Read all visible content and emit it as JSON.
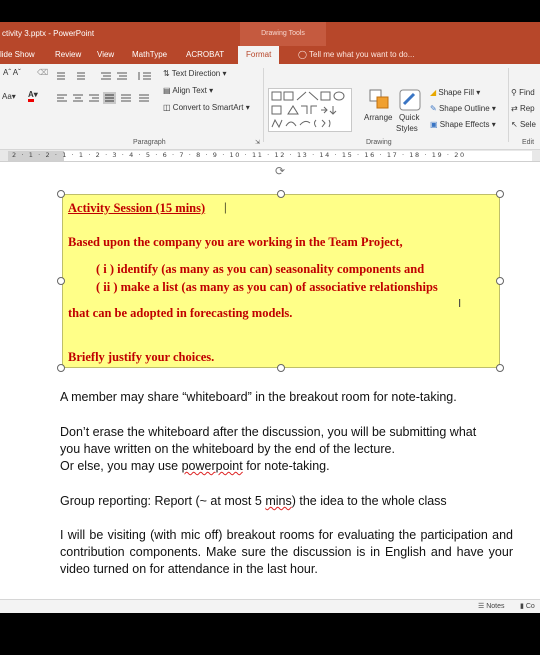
{
  "window": {
    "title": "ctivity 3.pptx - PowerPoint",
    "contextual_group": "Drawing Tools"
  },
  "tabs": {
    "items": [
      "lide Show",
      "Review",
      "View",
      "MathType",
      "ACROBAT",
      "Format"
    ],
    "active": "Format",
    "tell_me": "Tell me what you want to do..."
  },
  "ribbon": {
    "text_direction": "Text Direction",
    "align_text": "Align Text",
    "convert_smartart": "Convert to SmartArt",
    "arrange": "Arrange",
    "quick_styles_1": "Quick",
    "quick_styles_2": "Styles",
    "shape_fill": "Shape Fill",
    "shape_outline": "Shape Outline",
    "shape_effects": "Shape Effects",
    "find": "Find",
    "replace": "Rep",
    "select": "Sele",
    "groups": {
      "paragraph": "Paragraph",
      "drawing": "Drawing",
      "editing": "Edit"
    }
  },
  "ruler": {
    "numbers": "2 · 1 · 2 · 1 · 1 · 2 · 3 · 4 · 5 · 6 · 7 · 8 · 9 · 10 · 11 · 12 · 13 · 14 · 15 · 16 · 17 · 18 · 19 · 20"
  },
  "slide": {
    "box": {
      "heading": "Activity Session (15 mins)",
      "intro": "Based upon the company you are working in the Team Project,",
      "item1": "( i )  identify (as many as you can) seasonality components and",
      "item2": "( ii ) make a list (as many as you can) of associative relationships",
      "tail": "that can be adopted in forecasting models.",
      "justify": "Briefly justify your choices."
    },
    "p1": "A member may share “whiteboard” in the breakout room for note-taking.",
    "p2a": "Don’t erase the whiteboard after the discussion, you will be submitting what",
    "p2b": "you have written on the whiteboard by the end of the lecture.",
    "p2c_pre": "Or else, you may use ",
    "p2c_link": "powerpoint",
    "p2c_post": " for note-taking.",
    "p3_pre": "Group reporting:  Report (~ at most 5 ",
    "p3_mins": "mins",
    "p3_post": ") the idea to the whole class",
    "p4": "I will be visiting (with mic off) breakout rooms for evaluating the participation and contribution components.   Make sure the discussion is in English and have your video turned on for attendance in the last hour."
  },
  "status": {
    "notes": "Notes",
    "comments": "Co"
  },
  "colors": {
    "accent": "#b7472a",
    "box_fill": "#ffff88",
    "box_text": "#c00000"
  }
}
